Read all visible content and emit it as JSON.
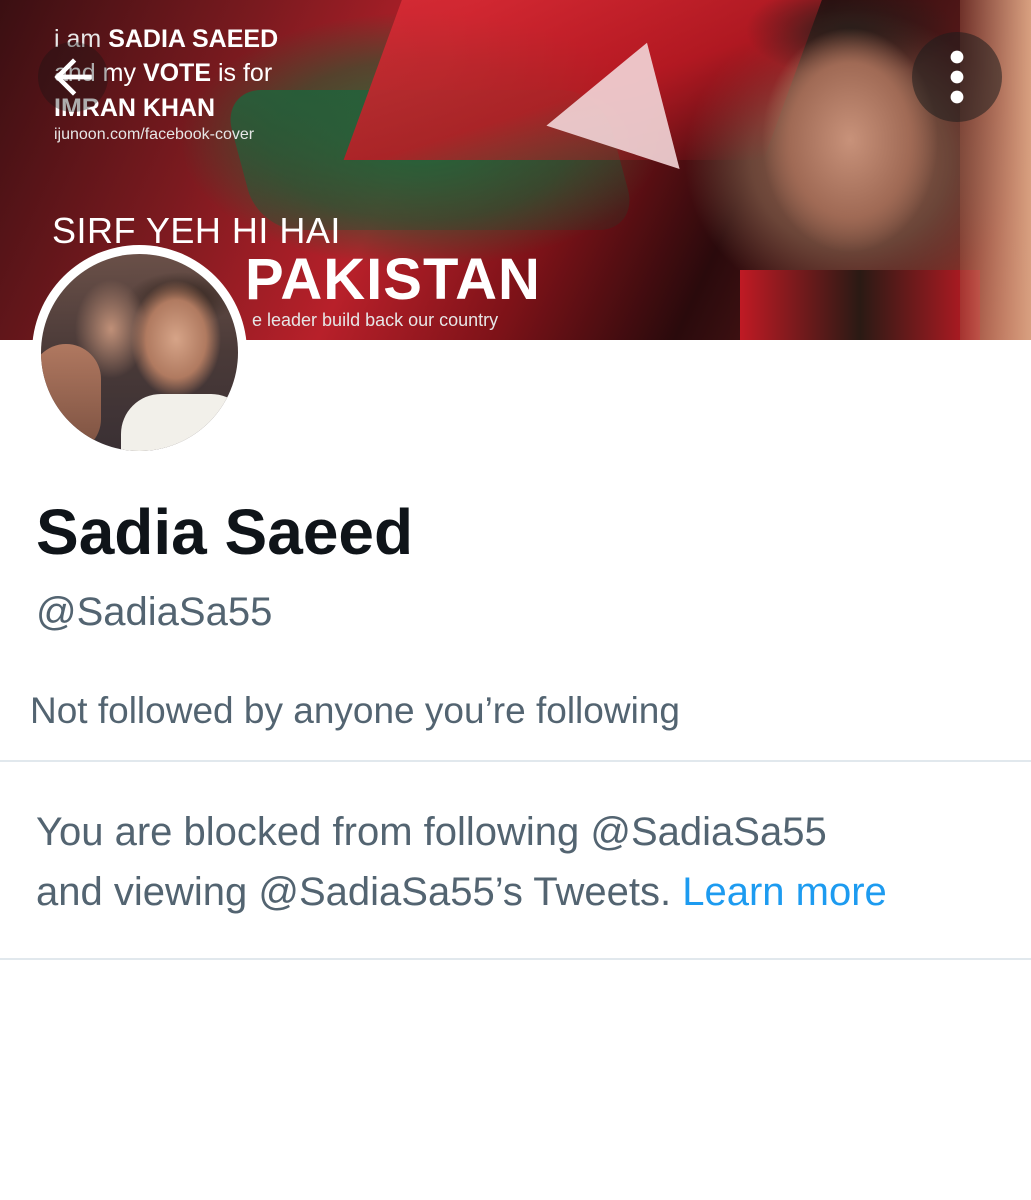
{
  "banner": {
    "line1_a": "i am",
    "line1_b": "SADIA SAEED",
    "line2_a": "and my",
    "line2_b": "VOTE",
    "line2_c": "is for",
    "line3": "IMRAN KHAN",
    "url": "ijunoon.com/facebook-cover",
    "headline1": "SIRF YEH HI HAI",
    "headline2": "PAKISTAN",
    "tagline": "e leader build back our country"
  },
  "nav": {
    "back_icon": "arrow-left-icon",
    "more_icon": "more-vertical-icon"
  },
  "profile": {
    "display_name": "Sadia Saeed",
    "handle": "@SadiaSa55",
    "followed_by": "Not followed by anyone you’re following"
  },
  "blocked": {
    "message_1": "You are blocked from following @SadiaSa55",
    "message_2": "and viewing @SadiaSa55’s Tweets.",
    "learn_more": "Learn more"
  },
  "colors": {
    "text_primary": "#0f1419",
    "text_secondary": "#536471",
    "link": "#1d9bf0",
    "divider": "#e1e8ed"
  }
}
